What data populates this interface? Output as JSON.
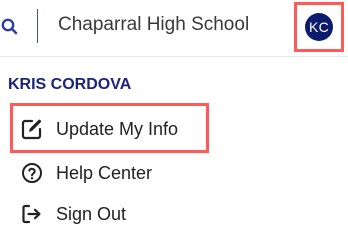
{
  "header": {
    "school_name": "Chaparral High School",
    "search_icon": "search-icon",
    "avatar_initials": "KC",
    "avatar_color": "#0d1b6e"
  },
  "user_menu": {
    "user_name": "KRIS CORDOVA",
    "items": [
      {
        "label": "Update My Info",
        "icon": "edit-icon"
      },
      {
        "label": "Help Center",
        "icon": "help-circle-icon"
      },
      {
        "label": "Sign Out",
        "icon": "sign-out-icon"
      }
    ]
  },
  "colors": {
    "accent": "#3f51b5",
    "highlight": "#ff5a57",
    "user_name": "#1a237e"
  }
}
